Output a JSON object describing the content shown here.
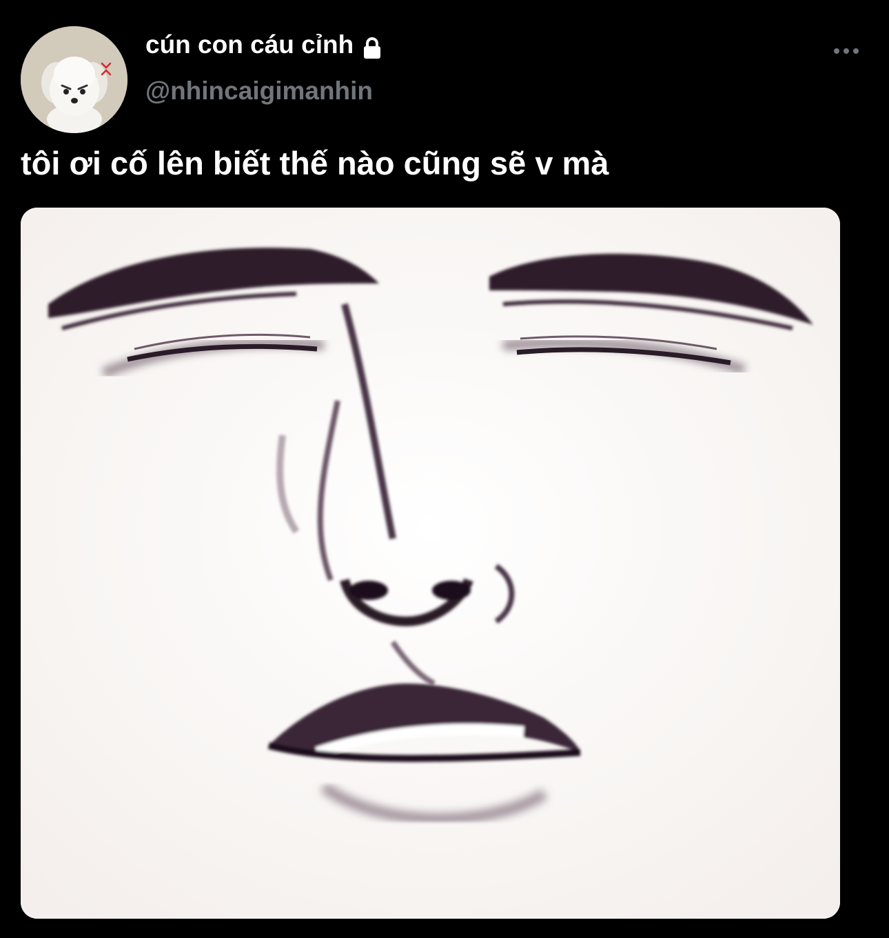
{
  "tweet": {
    "author": {
      "display_name": "cún con cáu cỉnh",
      "handle": "@nhincaigimanhin",
      "protected_icon": "lock-icon",
      "avatar": "white-puppy-avatar"
    },
    "text": "tôi ơi cố lên biết thế nào cũng sẽ v mà",
    "media": {
      "description_icon": "sketched-face-image"
    },
    "more_icon": "more-dots-icon"
  },
  "colors": {
    "background": "#000000",
    "name": "#ffffff",
    "handle": "#71767b",
    "ink": "#3a2530"
  }
}
